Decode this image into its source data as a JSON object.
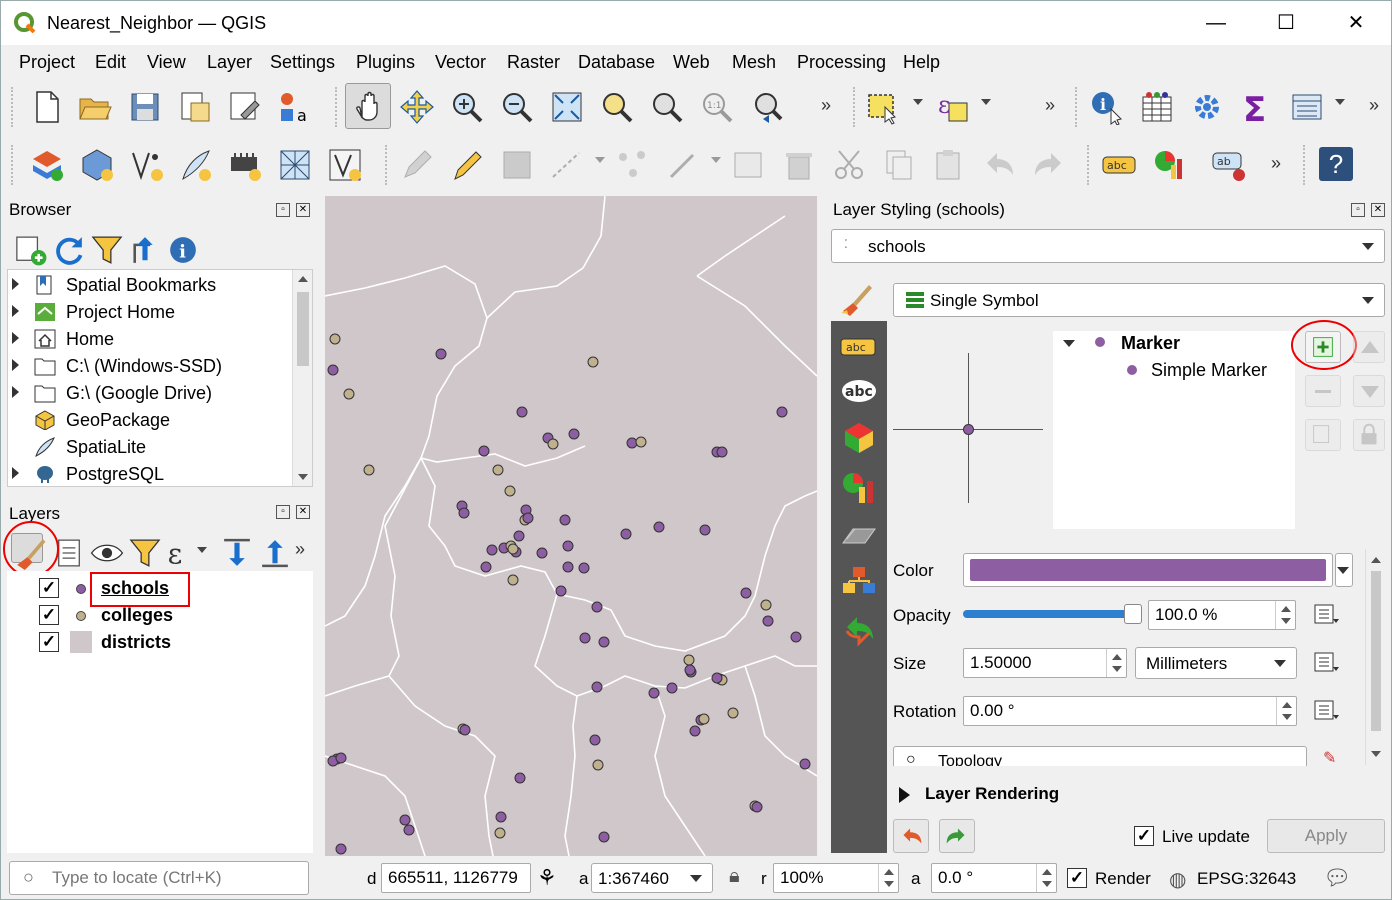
{
  "window": {
    "title": "Nearest_Neighbor — QGIS",
    "minimize": "—",
    "maximize": "☐",
    "close": "✕"
  },
  "menu": [
    "Project",
    "Edit",
    "View",
    "Layer",
    "Settings",
    "Plugins",
    "Vector",
    "Raster",
    "Database",
    "Web",
    "Mesh",
    "Processing",
    "Help"
  ],
  "toolbar_more": "»",
  "browser": {
    "title": "Browser",
    "items": [
      "Spatial Bookmarks",
      "Project Home",
      "Home",
      "C:\\ (Windows-SSD)",
      "G:\\ (Google Drive)",
      "GeoPackage",
      "SpatiaLite",
      "PostgreSQL"
    ]
  },
  "layers": {
    "title": "Layers",
    "items": [
      {
        "name": "schools",
        "color": "#8e5ea2"
      },
      {
        "name": "colleges",
        "color": "#bfb08e"
      },
      {
        "name": "districts",
        "color": "#d0c7cb"
      }
    ]
  },
  "styling": {
    "title": "Layer Styling (schools)",
    "layer_combo": "schools",
    "renderer": "Single Symbol",
    "tree": {
      "root": "Marker",
      "child": "Simple Marker"
    },
    "color_label": "Color",
    "color": "#8e5ea2",
    "opacity_label": "Opacity",
    "opacity": "100.0 %",
    "opacity_fraction": 1.0,
    "size_label": "Size",
    "size": "1.50000",
    "unit": "Millimeters",
    "rotation_label": "Rotation",
    "rotation": "0.00 °",
    "search_partial": "Topology",
    "layer_rendering": "Layer Rendering",
    "live_update": "Live update",
    "apply": "Apply"
  },
  "status": {
    "locate_placeholder": "Type to locate (Ctrl+K)",
    "coord_label": "d",
    "coord": "665511, 1126779",
    "scale_label": "a",
    "scale": "1:367460",
    "mag_label": "r",
    "magnifier": "100%",
    "rot_label": "a",
    "rotation": "0.0 °",
    "render": "Render",
    "crs": "EPSG:32643"
  }
}
